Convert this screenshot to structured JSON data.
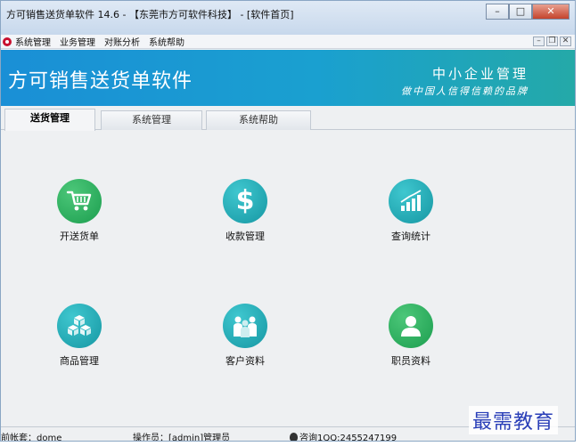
{
  "window": {
    "title": "方可销售送货单软件 14.6 - 【东莞市方可软件科技】 - [软件首页]",
    "minimize_label": "–",
    "maximize_label": "□",
    "close_label": "✕"
  },
  "menu": {
    "items": [
      "系统管理",
      "业务管理",
      "对账分析",
      "系统帮助"
    ],
    "mdi_minimize": "–",
    "mdi_restore": "❐",
    "mdi_close": "✕"
  },
  "banner": {
    "title": "方可销售送货单软件",
    "slogan_main": "中小企业管理",
    "slogan_sub": "做中国人信得信赖的品牌"
  },
  "tabs": [
    {
      "label": "送货管理",
      "active": true
    },
    {
      "label": "系统管理",
      "active": false
    },
    {
      "label": "系统帮助",
      "active": false
    }
  ],
  "tiles": [
    {
      "label": "开送货单",
      "icon": "shopping-cart-icon",
      "color": "#1c9e4f"
    },
    {
      "label": "收款管理",
      "icon": "dollar-icon",
      "color": "#1697a3"
    },
    {
      "label": "查询统计",
      "icon": "bar-chart-icon",
      "color": "#1697a3"
    },
    {
      "label": "商品管理",
      "icon": "boxes-icon",
      "color": "#1697a3"
    },
    {
      "label": "客户资料",
      "icon": "customers-icon",
      "color": "#1697a3"
    },
    {
      "label": "职员资料",
      "icon": "staff-icon",
      "color": "#1c9e4f"
    }
  ],
  "status": {
    "account": "前帐套：dome",
    "operator": "操作员：[admin]管理员",
    "contact": "咨询1QQ:2455247199"
  },
  "watermark": "最需教育"
}
